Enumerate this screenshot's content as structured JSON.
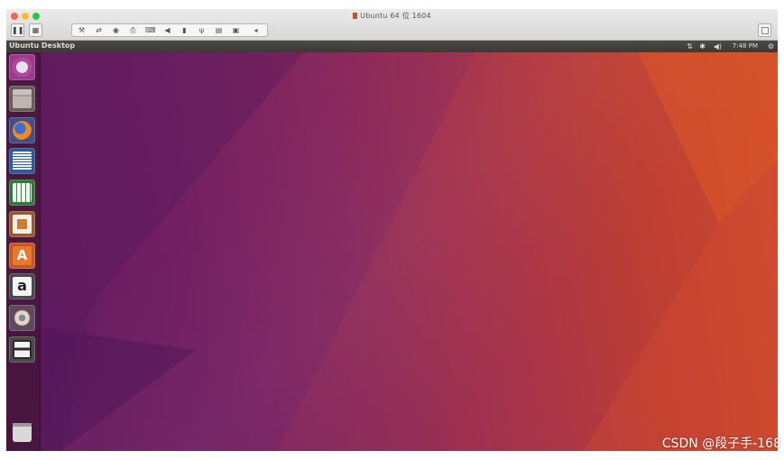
{
  "window": {
    "title": "Ubuntu 64 位 1604",
    "toolbar_icons": [
      "pause-icon",
      "snapshot-icon",
      "wrench-icon",
      "network-arrows-icon",
      "cd-icon",
      "printer-icon",
      "keyboard-icon",
      "sound-icon",
      "usb-stick-icon",
      "usb-icon",
      "floppy-icon",
      "camera-icon",
      "arrow-left-icon",
      "window-icon"
    ]
  },
  "panel": {
    "title": "Ubuntu Desktop",
    "time": "7:48 PM",
    "indicators": [
      "network-arrows-icon",
      "bluetooth-icon",
      "volume-icon",
      "gear-icon"
    ]
  },
  "launcher": {
    "items": [
      {
        "name": "ubuntu-dash-icon"
      },
      {
        "name": "files-icon"
      },
      {
        "name": "firefox-icon"
      },
      {
        "name": "libreoffice-writer-icon"
      },
      {
        "name": "libreoffice-calc-icon"
      },
      {
        "name": "libreoffice-impress-icon"
      },
      {
        "name": "ubuntu-software-icon"
      },
      {
        "name": "amazon-icon"
      },
      {
        "name": "system-settings-icon"
      },
      {
        "name": "floppy-disk-icon"
      }
    ],
    "trash": "trash-icon"
  },
  "watermark": "CSDN @段子手-168"
}
